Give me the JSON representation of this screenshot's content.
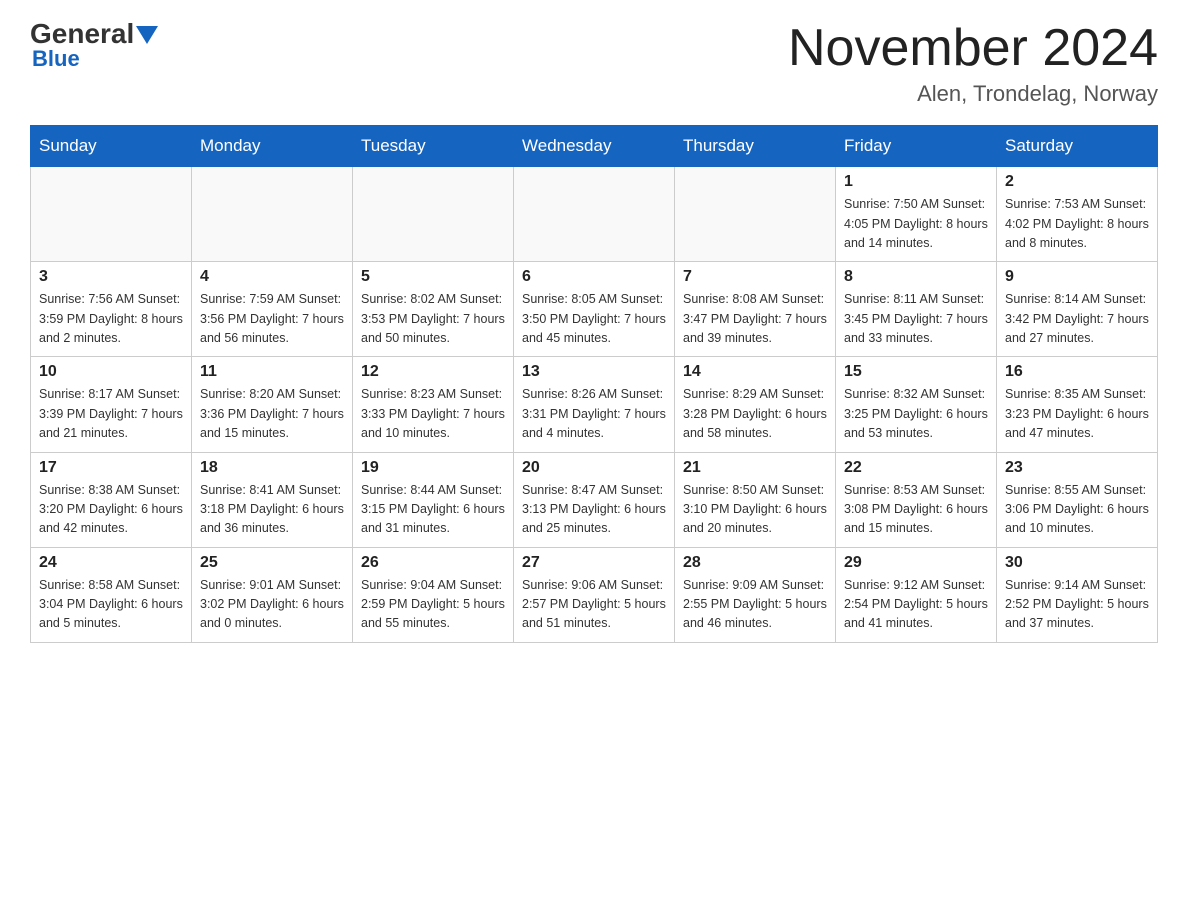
{
  "header": {
    "logo_line1": "General",
    "logo_line2": "Blue",
    "month_title": "November 2024",
    "location": "Alen, Trondelag, Norway"
  },
  "weekdays": [
    "Sunday",
    "Monday",
    "Tuesday",
    "Wednesday",
    "Thursday",
    "Friday",
    "Saturday"
  ],
  "weeks": [
    [
      {
        "day": "",
        "info": ""
      },
      {
        "day": "",
        "info": ""
      },
      {
        "day": "",
        "info": ""
      },
      {
        "day": "",
        "info": ""
      },
      {
        "day": "",
        "info": ""
      },
      {
        "day": "1",
        "info": "Sunrise: 7:50 AM\nSunset: 4:05 PM\nDaylight: 8 hours\nand 14 minutes."
      },
      {
        "day": "2",
        "info": "Sunrise: 7:53 AM\nSunset: 4:02 PM\nDaylight: 8 hours\nand 8 minutes."
      }
    ],
    [
      {
        "day": "3",
        "info": "Sunrise: 7:56 AM\nSunset: 3:59 PM\nDaylight: 8 hours\nand 2 minutes."
      },
      {
        "day": "4",
        "info": "Sunrise: 7:59 AM\nSunset: 3:56 PM\nDaylight: 7 hours\nand 56 minutes."
      },
      {
        "day": "5",
        "info": "Sunrise: 8:02 AM\nSunset: 3:53 PM\nDaylight: 7 hours\nand 50 minutes."
      },
      {
        "day": "6",
        "info": "Sunrise: 8:05 AM\nSunset: 3:50 PM\nDaylight: 7 hours\nand 45 minutes."
      },
      {
        "day": "7",
        "info": "Sunrise: 8:08 AM\nSunset: 3:47 PM\nDaylight: 7 hours\nand 39 minutes."
      },
      {
        "day": "8",
        "info": "Sunrise: 8:11 AM\nSunset: 3:45 PM\nDaylight: 7 hours\nand 33 minutes."
      },
      {
        "day": "9",
        "info": "Sunrise: 8:14 AM\nSunset: 3:42 PM\nDaylight: 7 hours\nand 27 minutes."
      }
    ],
    [
      {
        "day": "10",
        "info": "Sunrise: 8:17 AM\nSunset: 3:39 PM\nDaylight: 7 hours\nand 21 minutes."
      },
      {
        "day": "11",
        "info": "Sunrise: 8:20 AM\nSunset: 3:36 PM\nDaylight: 7 hours\nand 15 minutes."
      },
      {
        "day": "12",
        "info": "Sunrise: 8:23 AM\nSunset: 3:33 PM\nDaylight: 7 hours\nand 10 minutes."
      },
      {
        "day": "13",
        "info": "Sunrise: 8:26 AM\nSunset: 3:31 PM\nDaylight: 7 hours\nand 4 minutes."
      },
      {
        "day": "14",
        "info": "Sunrise: 8:29 AM\nSunset: 3:28 PM\nDaylight: 6 hours\nand 58 minutes."
      },
      {
        "day": "15",
        "info": "Sunrise: 8:32 AM\nSunset: 3:25 PM\nDaylight: 6 hours\nand 53 minutes."
      },
      {
        "day": "16",
        "info": "Sunrise: 8:35 AM\nSunset: 3:23 PM\nDaylight: 6 hours\nand 47 minutes."
      }
    ],
    [
      {
        "day": "17",
        "info": "Sunrise: 8:38 AM\nSunset: 3:20 PM\nDaylight: 6 hours\nand 42 minutes."
      },
      {
        "day": "18",
        "info": "Sunrise: 8:41 AM\nSunset: 3:18 PM\nDaylight: 6 hours\nand 36 minutes."
      },
      {
        "day": "19",
        "info": "Sunrise: 8:44 AM\nSunset: 3:15 PM\nDaylight: 6 hours\nand 31 minutes."
      },
      {
        "day": "20",
        "info": "Sunrise: 8:47 AM\nSunset: 3:13 PM\nDaylight: 6 hours\nand 25 minutes."
      },
      {
        "day": "21",
        "info": "Sunrise: 8:50 AM\nSunset: 3:10 PM\nDaylight: 6 hours\nand 20 minutes."
      },
      {
        "day": "22",
        "info": "Sunrise: 8:53 AM\nSunset: 3:08 PM\nDaylight: 6 hours\nand 15 minutes."
      },
      {
        "day": "23",
        "info": "Sunrise: 8:55 AM\nSunset: 3:06 PM\nDaylight: 6 hours\nand 10 minutes."
      }
    ],
    [
      {
        "day": "24",
        "info": "Sunrise: 8:58 AM\nSunset: 3:04 PM\nDaylight: 6 hours\nand 5 minutes."
      },
      {
        "day": "25",
        "info": "Sunrise: 9:01 AM\nSunset: 3:02 PM\nDaylight: 6 hours\nand 0 minutes."
      },
      {
        "day": "26",
        "info": "Sunrise: 9:04 AM\nSunset: 2:59 PM\nDaylight: 5 hours\nand 55 minutes."
      },
      {
        "day": "27",
        "info": "Sunrise: 9:06 AM\nSunset: 2:57 PM\nDaylight: 5 hours\nand 51 minutes."
      },
      {
        "day": "28",
        "info": "Sunrise: 9:09 AM\nSunset: 2:55 PM\nDaylight: 5 hours\nand 46 minutes."
      },
      {
        "day": "29",
        "info": "Sunrise: 9:12 AM\nSunset: 2:54 PM\nDaylight: 5 hours\nand 41 minutes."
      },
      {
        "day": "30",
        "info": "Sunrise: 9:14 AM\nSunset: 2:52 PM\nDaylight: 5 hours\nand 37 minutes."
      }
    ]
  ]
}
